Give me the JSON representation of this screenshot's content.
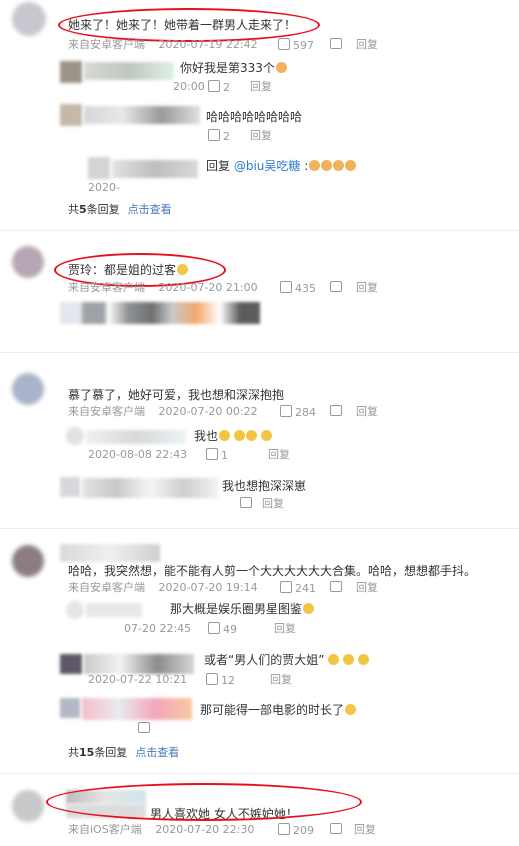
{
  "comments": [
    {
      "text": "她来了！她来了！她带着一群男人走来了！",
      "source": "来自安卓客户端",
      "time": "2020-07-19 22:42",
      "likes": "597",
      "reply_label": "回复",
      "replies": [
        {
          "text": "你好我是第333个",
          "time": "20:00",
          "likes": "2",
          "reply_label": "回复"
        },
        {
          "text": "哈哈哈哈哈哈哈哈",
          "likes": "2",
          "reply_label": "回复"
        },
        {
          "text": "回复",
          "mention": "@biu吴吃糖",
          "suffix": " :",
          "time": "2020-"
        }
      ],
      "more": {
        "count_prefix": "共",
        "count": "5",
        "count_suffix": "条回复",
        "link": "点击查看"
      }
    },
    {
      "text": "贾玲：都是姐的过客",
      "source": "来自安卓客户端",
      "time": "2020-07-20 21:00",
      "likes": "435",
      "reply_label": "回复"
    },
    {
      "text": "慕了慕了，她好可爱，我也想和深深抱抱",
      "source": "来自安卓客户端",
      "time": "2020-07-20 00:22",
      "likes": "284",
      "reply_label": "回复",
      "replies": [
        {
          "text": "我也",
          "time": "2020-08-08 22:43",
          "likes": "1",
          "reply_label": "回复"
        },
        {
          "text": "我也想抱深深崽",
          "reply_label": "回复"
        }
      ]
    },
    {
      "text": "哈哈，我突然想，能不能有人剪一个大大大大大大合集。哈哈，想想都手抖。",
      "source": "来自安卓客户端",
      "time": "2020-07-20 19:14",
      "likes": "241",
      "reply_label": "回复",
      "replies": [
        {
          "text": "那大概是娱乐圈男星图鉴",
          "time": "07-20 22:45",
          "likes": "49",
          "reply_label": "回复"
        },
        {
          "text": "或者“男人们的贾大姐”",
          "time": "2020-07-22 10:21",
          "likes": "12",
          "reply_label": "回复"
        },
        {
          "text": "那可能得一部电影的时长了"
        }
      ],
      "more": {
        "count_prefix": "共",
        "count": "15",
        "count_suffix": "条回复",
        "link": "点击查看"
      }
    },
    {
      "text": "男人喜欢她 女人不嫉妒她！",
      "source": "来自iOS客户端",
      "time": "2020-07-20 22:30",
      "likes": "209",
      "reply_label": "回复"
    }
  ],
  "colors": {
    "highlight_circle": "#e8101c",
    "link": "#4a77b9",
    "mention": "#2d7bd3"
  }
}
